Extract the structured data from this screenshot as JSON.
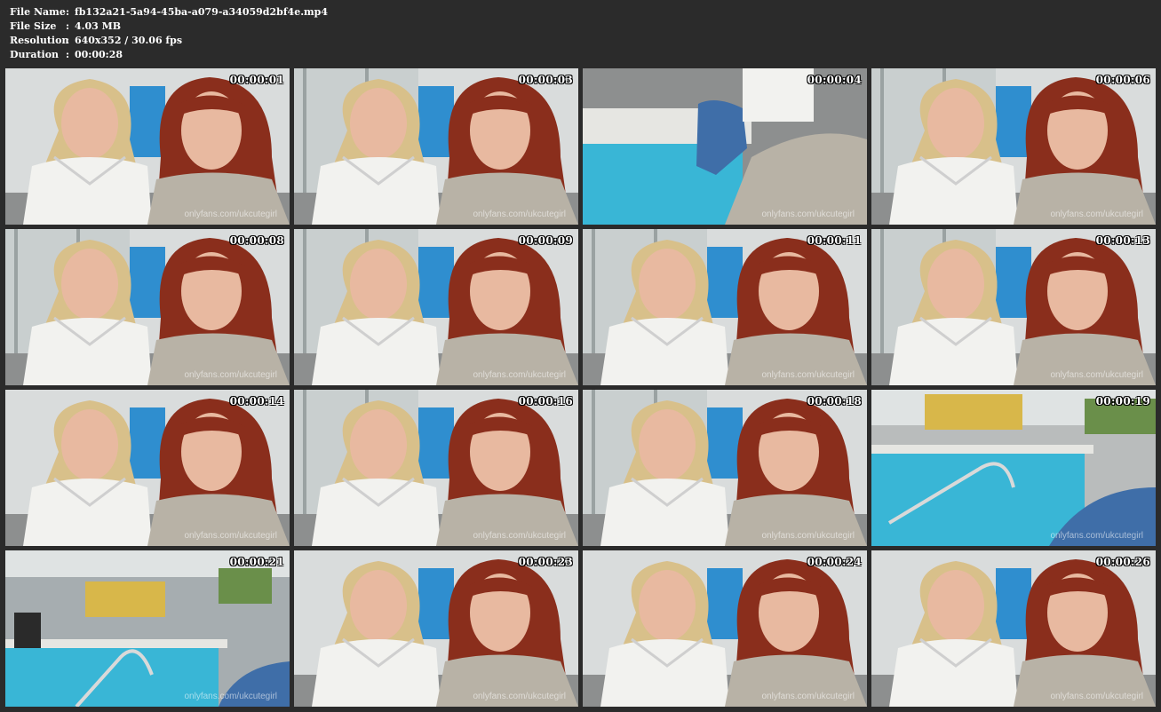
{
  "header": {
    "rows": [
      {
        "key": "File Name",
        "sep": ":",
        "value": "fb132a21-5a94-45ba-a079-a34059d2bf4e.mp4"
      },
      {
        "key": "File Size",
        "sep": ":",
        "value": "4.03 MB"
      },
      {
        "key": "Resolution",
        "sep": ":",
        "value": "640x352 / 30.06 fps"
      },
      {
        "key": "Duration",
        "sep": ":",
        "value": "00:00:28"
      }
    ]
  },
  "thumbnails": [
    {
      "time": "00:00:01",
      "watermark": "onlyfans.com/ukcutegirl",
      "scene": "selfie-wall"
    },
    {
      "time": "00:00:03",
      "watermark": "onlyfans.com/ukcutegirl",
      "scene": "selfie-window"
    },
    {
      "time": "00:00:04",
      "watermark": "onlyfans.com/ukcutegirl",
      "scene": "pool-legs"
    },
    {
      "time": "00:00:06",
      "watermark": "onlyfans.com/ukcutegirl",
      "scene": "selfie-window"
    },
    {
      "time": "00:00:08",
      "watermark": "onlyfans.com/ukcutegirl",
      "scene": "selfie-window"
    },
    {
      "time": "00:00:09",
      "watermark": "onlyfans.com/ukcutegirl",
      "scene": "selfie-window"
    },
    {
      "time": "00:00:11",
      "watermark": "onlyfans.com/ukcutegirl",
      "scene": "selfie-window"
    },
    {
      "time": "00:00:13",
      "watermark": "onlyfans.com/ukcutegirl",
      "scene": "selfie-window"
    },
    {
      "time": "00:00:14",
      "watermark": "onlyfans.com/ukcutegirl",
      "scene": "selfie-wall"
    },
    {
      "time": "00:00:16",
      "watermark": "onlyfans.com/ukcutegirl",
      "scene": "selfie-window"
    },
    {
      "time": "00:00:18",
      "watermark": "onlyfans.com/ukcutegirl",
      "scene": "selfie-window"
    },
    {
      "time": "00:00:19",
      "watermark": "onlyfans.com/ukcutegirl",
      "scene": "pool-steps"
    },
    {
      "time": "00:00:21",
      "watermark": "onlyfans.com/ukcutegirl",
      "scene": "pool-wide"
    },
    {
      "time": "00:00:23",
      "watermark": "onlyfans.com/ukcutegirl",
      "scene": "selfie-wall"
    },
    {
      "time": "00:00:24",
      "watermark": "onlyfans.com/ukcutegirl",
      "scene": "selfie-wall"
    },
    {
      "time": "00:00:26",
      "watermark": "onlyfans.com/ukcutegirl",
      "scene": "selfie-wall"
    }
  ],
  "colors": {
    "background": "#2b2b2b",
    "text": "#ffffff",
    "blonde_hair": "#d8c08a",
    "red_hair": "#8a2e1c",
    "skin": "#e8b9a0",
    "white_top": "#f2f2ef",
    "grey_sweater": "#b8b2a6",
    "pool_water": "#39b6d6",
    "wall_blue": "#2f8ecf"
  }
}
